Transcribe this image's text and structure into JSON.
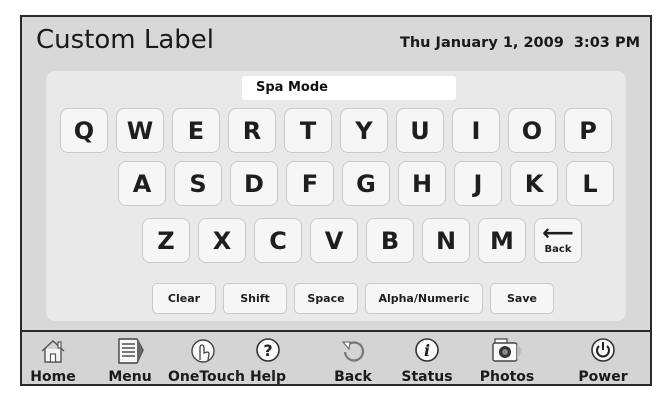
{
  "header": {
    "title": "Custom Label",
    "date": "Thu January 1, 2009",
    "time": "3:03 PM"
  },
  "input": {
    "value": "Spa Mode"
  },
  "keyboard": {
    "row1": [
      "Q",
      "W",
      "E",
      "R",
      "T",
      "Y",
      "U",
      "I",
      "O",
      "P"
    ],
    "row2": [
      "A",
      "S",
      "D",
      "F",
      "G",
      "H",
      "J",
      "K",
      "L"
    ],
    "row3": [
      "Z",
      "X",
      "C",
      "V",
      "B",
      "N",
      "M"
    ],
    "back_label": "Back",
    "back_arrow": "⟵"
  },
  "function_keys": {
    "clear": "Clear",
    "shift": "Shift",
    "space": "Space",
    "alpha_numeric": "Alpha/Numeric",
    "save": "Save"
  },
  "nav": {
    "home": "Home",
    "menu": "Menu",
    "onetouch": "OneTouch",
    "help": "Help",
    "back": "Back",
    "status": "Status",
    "photos": "Photos",
    "power": "Power",
    "help_glyph": "?",
    "status_glyph": "i"
  },
  "icons": {
    "home": "home-icon",
    "menu": "menu-icon",
    "onetouch": "onetouch-icon",
    "help": "help-icon",
    "back": "back-icon",
    "status": "status-icon",
    "photos": "camera-icon",
    "power": "power-icon"
  },
  "colors": {
    "background": "#d8d8d8",
    "panel": "#e9e9e9",
    "key": "#f6f6f6",
    "border": "#2a2a2a"
  }
}
